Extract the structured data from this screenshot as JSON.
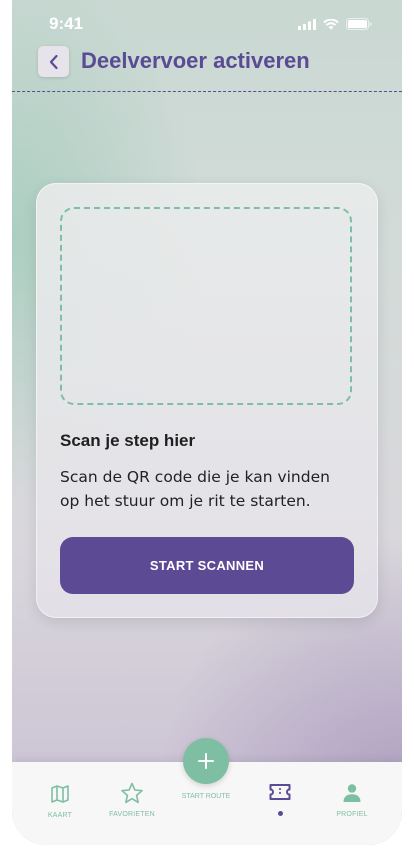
{
  "status_bar": {
    "time": "9:41"
  },
  "header": {
    "title": "Deelvervoer activeren"
  },
  "card": {
    "title": "Scan je step hier",
    "description": "Scan de QR code die je kan vinden op het stuur om je rit te starten.",
    "button_label": "START SCANNEN"
  },
  "tabbar": {
    "items": [
      {
        "label": "KAART",
        "icon": "map-icon"
      },
      {
        "label": "FAVORIETEN",
        "icon": "star-icon"
      },
      {
        "label": "START ROUTE",
        "icon": "plus-icon"
      },
      {
        "label": "",
        "icon": "ticket-icon",
        "active": true
      },
      {
        "label": "PROFIEL",
        "icon": "person-icon"
      }
    ]
  },
  "colors": {
    "primary": "#5c4a94",
    "accent": "#7ebfa3"
  }
}
